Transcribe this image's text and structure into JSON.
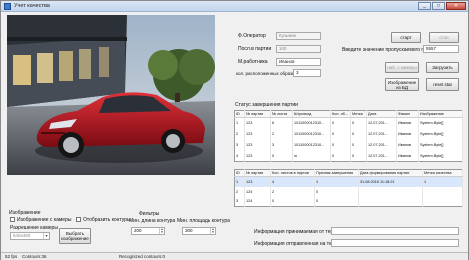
{
  "window": {
    "title": "Учет качества",
    "min": "_",
    "max": "□",
    "close": "✕"
  },
  "video": {
    "fps_overlay": ""
  },
  "form": {
    "operator_label": "Ф.Оператор",
    "operator_value": "Кузьмин",
    "last_sheet_label": "Посл.в партии",
    "last_sheet_value": "100",
    "worker_label": "М.работника",
    "worker_value": "Иванов",
    "samples_label": "кол. расположенных образцов",
    "samples_value": "3",
    "start_label": "старт",
    "stop_label": "стоп",
    "threshold_label": "Введите значение пропускаемого порога",
    "threshold_value": "5557",
    "cam_button": "наб. с камеры",
    "load_button": "Загрузить",
    "save_db_button": "Изображение из БД",
    "reset_button": "reset stat"
  },
  "batch_table": {
    "title": "Статус завершения партии",
    "columns": [
      "ID",
      "№ партии",
      "№ листа",
      "Штрихкод",
      "Кол. об...",
      "Метка",
      "Дата",
      "Фамил",
      "Изображение"
    ],
    "rows": [
      [
        "1",
        "123",
        "6",
        "1011000012310...",
        "0",
        "0",
        "12.07.201...",
        "Иванов",
        "System.Byte[]"
      ],
      [
        "2",
        "123",
        "2",
        "1011000012310...",
        "0",
        "0",
        "12.07.201...",
        "Иванов",
        "System.Byte[]"
      ],
      [
        "3",
        "123",
        "3",
        "1011000012310...",
        "0",
        "0",
        "12.07.201...",
        "Иванов",
        "System.Byte[]"
      ],
      [
        "4",
        "123",
        "0",
        "m",
        "0",
        "0",
        "12.07.201...",
        "Иванов",
        "System.Byte[]"
      ]
    ]
  },
  "log_table": {
    "columns": [
      "ID",
      "№ партии",
      "Кол. листов в партии",
      "Признак завершения",
      "Дата формирования партии",
      "Метка качества"
    ],
    "rows": [
      [
        "1",
        "123",
        "4",
        "1",
        "31.08.2015 11:18:21",
        "1"
      ],
      [
        "2",
        "124",
        "2",
        "0",
        "",
        ""
      ],
      [
        "3",
        "124",
        "0",
        "0",
        "",
        ""
      ]
    ]
  },
  "image_panel": {
    "title": "Изображение",
    "camera_checkbox": "Изображение с камеры",
    "contours_checkbox": "Отобразить контуры",
    "resolution_label": "Разрешение камеры",
    "resolution_value": "640x480",
    "choose_button": "Выбрать изображение"
  },
  "filters": {
    "title": "Фильтры",
    "min_length_label": "Мин. длина контура",
    "min_length_value": "200",
    "min_area_label": "Мин. площадь контура",
    "min_area_value": "300"
  },
  "info": {
    "terminal_sent_label": "Информация принимаемая от терминала",
    "terminal_recv_label": "Информация отправленная на терминал"
  },
  "status": {
    "fps": "52 fps",
    "contours": "Contours:36",
    "recognized": "Recognized contours:0"
  }
}
